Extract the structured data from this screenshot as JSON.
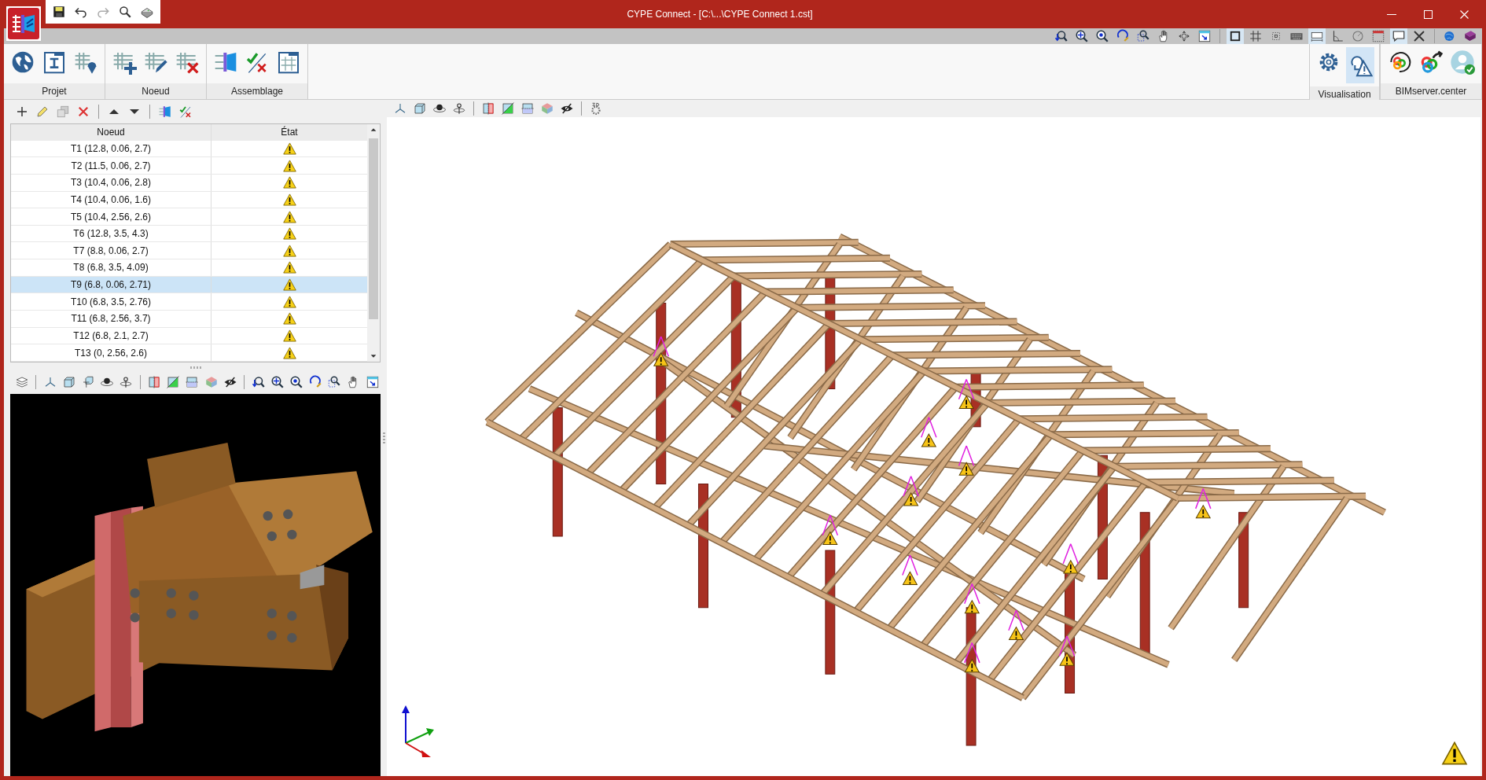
{
  "window": {
    "title": "CYPE Connect - [C:\\...\\CYPE Connect 1.cst]"
  },
  "top_toolbar": [
    {
      "kind": "zoom-back",
      "on": false
    },
    {
      "kind": "zoom-all",
      "on": false
    },
    {
      "kind": "zoom-double",
      "on": false
    },
    {
      "kind": "zoom-redraw",
      "on": false
    },
    {
      "kind": "zoom-window",
      "on": false
    },
    {
      "kind": "hand",
      "on": false
    },
    {
      "kind": "orbit",
      "on": false
    },
    {
      "kind": "window-arrow",
      "on": false
    },
    {
      "kind": "square",
      "on": true
    },
    {
      "kind": "grid",
      "on": false
    },
    {
      "kind": "snap",
      "on": false
    },
    {
      "kind": "keyboard",
      "on": false
    },
    {
      "kind": "ruler",
      "on": true
    },
    {
      "kind": "angle",
      "on": false
    },
    {
      "kind": "circle",
      "on": false
    },
    {
      "kind": "panel",
      "on": false
    },
    {
      "kind": "speech",
      "on": true
    },
    {
      "kind": "tools",
      "on": false
    },
    {
      "kind": "web",
      "on": false
    },
    {
      "kind": "book",
      "on": false
    }
  ],
  "ribbon": {
    "groups": [
      {
        "label": "Projet",
        "buttons": [
          {
            "kind": "globe"
          },
          {
            "kind": "sheet"
          },
          {
            "kind": "frame-pin"
          }
        ]
      },
      {
        "label": "Noeud",
        "buttons": [
          {
            "kind": "frame-plus"
          },
          {
            "kind": "frame-pencil"
          },
          {
            "kind": "frame-cross"
          }
        ]
      },
      {
        "label": "Assemblage",
        "buttons": [
          {
            "kind": "joint"
          },
          {
            "kind": "check-cross"
          },
          {
            "kind": "frame-sheet"
          }
        ]
      }
    ],
    "right_groups": [
      {
        "label": "Visualisation",
        "buttons": [
          {
            "kind": "gear",
            "on": false
          },
          {
            "kind": "bulb-warning",
            "on": true
          }
        ]
      },
      {
        "label": "BIMserver.center",
        "buttons": [
          {
            "kind": "rings-sync",
            "on": false
          },
          {
            "kind": "rings-share",
            "on": false
          },
          {
            "kind": "user",
            "on": false
          }
        ]
      }
    ]
  },
  "nodes_table": {
    "columns": [
      "Noeud",
      "État"
    ],
    "rows": [
      {
        "node": "T1 (12.8, 0.06, 2.7)",
        "warning": true,
        "selected": false
      },
      {
        "node": "T2 (11.5, 0.06, 2.7)",
        "warning": true,
        "selected": false
      },
      {
        "node": "T3 (10.4, 0.06, 2.8)",
        "warning": true,
        "selected": false
      },
      {
        "node": "T4 (10.4, 0.06, 1.6)",
        "warning": true,
        "selected": false
      },
      {
        "node": "T5 (10.4, 2.56, 2.6)",
        "warning": true,
        "selected": false
      },
      {
        "node": "T6 (12.8, 3.5, 4.3)",
        "warning": true,
        "selected": false
      },
      {
        "node": "T7 (8.8, 0.06, 2.7)",
        "warning": true,
        "selected": false
      },
      {
        "node": "T8 (6.8, 3.5, 4.09)",
        "warning": true,
        "selected": false
      },
      {
        "node": "T9 (6.8, 0.06, 2.71)",
        "warning": true,
        "selected": true
      },
      {
        "node": "T10 (6.8, 3.5, 2.76)",
        "warning": true,
        "selected": false
      },
      {
        "node": "T11 (6.8, 2.56, 3.7)",
        "warning": true,
        "selected": false
      },
      {
        "node": "T12 (6.8, 2.1, 2.7)",
        "warning": true,
        "selected": false
      },
      {
        "node": "T13 (0, 2.56, 2.6)",
        "warning": true,
        "selected": false
      }
    ]
  },
  "model_view": {
    "warning": true
  }
}
